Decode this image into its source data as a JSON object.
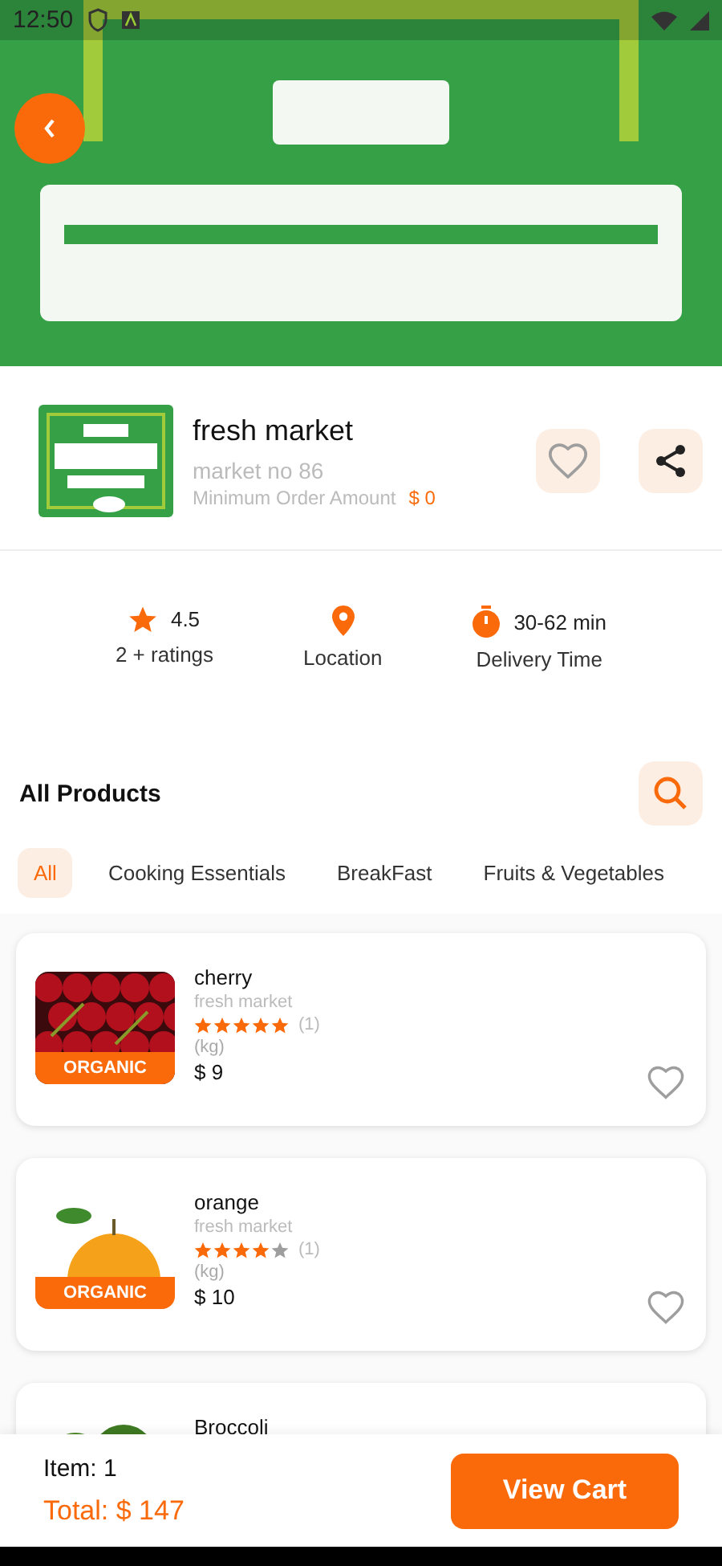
{
  "status_bar": {
    "time": "12:50"
  },
  "store": {
    "name": "fresh market",
    "subtitle": "market no 86",
    "min_order_label": "Minimum Order Amount",
    "min_order_value": "$ 0",
    "favorite": false
  },
  "stats": [
    {
      "kind": "rating",
      "value": "4.5",
      "label": "2 + ratings"
    },
    {
      "kind": "location",
      "label": "Location"
    },
    {
      "kind": "time",
      "value": "30-62 min",
      "label": "Delivery Time"
    }
  ],
  "section": {
    "title": "All Products"
  },
  "tabs": [
    {
      "label": "All",
      "selected": true
    },
    {
      "label": "Cooking Essentials",
      "selected": false
    },
    {
      "label": "BreakFast",
      "selected": false
    },
    {
      "label": "Fruits & Vegetables",
      "selected": false
    }
  ],
  "products": [
    {
      "name": "cherry",
      "kind": "cherry",
      "store": "fresh market",
      "stars": 5,
      "reviews": "(1)",
      "unit": "(kg)",
      "price": "$ 9",
      "badge": "ORGANIC",
      "favorite": false
    },
    {
      "name": "orange",
      "kind": "orange",
      "store": "fresh market",
      "stars": 4,
      "reviews": "(1)",
      "unit": "(kg)",
      "price": "$ 10",
      "badge": "ORGANIC",
      "favorite": false
    },
    {
      "name": "Broccoli",
      "kind": "broccoli"
    }
  ],
  "footer": {
    "items": "Item: 1",
    "total": "Total: $ 147",
    "button": "View Cart"
  }
}
